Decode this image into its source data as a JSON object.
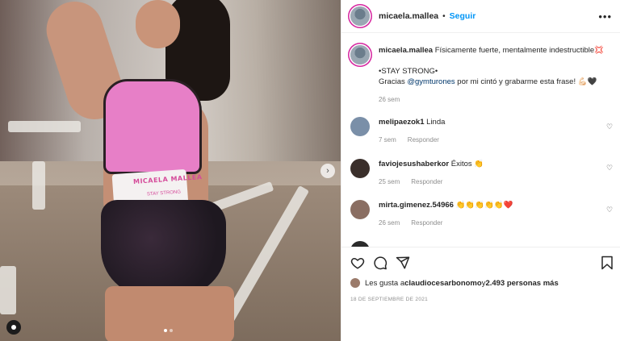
{
  "post": {
    "username": "micaela.mallea",
    "follow_label": "Seguir",
    "separator": "•",
    "more_label": "•••",
    "belt_text_1": "MICAELA MALLEA",
    "belt_text_2": "STAY STRONG",
    "carousel": {
      "total_slides": 2,
      "current_slide": 1
    }
  },
  "caption": {
    "username": "micaela.mallea",
    "text_1": "Físicamente fuerte, mentalmente indestructible",
    "emoji_1": "💢",
    "text_2": "•STAY STRONG•",
    "text_3_pre": "Gracias ",
    "mention": "@gymturones",
    "text_3_post": " por mi cintó y grabarme esta frase! ",
    "emoji_2": "💪🏻🖤",
    "time": "26 sem"
  },
  "comments": [
    {
      "username": "melipaezok1",
      "text": "Linda",
      "time": "7 sem",
      "reply": "Responder",
      "avatar_color": "#7a8fa8"
    },
    {
      "username": "faviojesushaberkor",
      "text": "Éxitos ",
      "emoji": "👏",
      "time": "25 sem",
      "reply": "Responder",
      "avatar_color": "#3a2f2b"
    },
    {
      "username": "mirta.gimenez.54966",
      "text": "",
      "emoji": "👏👏👏👏👏❤️",
      "time": "26 sem",
      "reply": "Responder",
      "avatar_color": "#8a6e62"
    }
  ],
  "actions": {
    "likes_prefix": "Les gusta a ",
    "likes_user": "claudiocesarbonomo",
    "likes_mid": " y ",
    "likes_count": "2.493 personas más",
    "date": "18 DE SEPTIEMBRE DE 2021"
  },
  "icons": [
    "heart-icon",
    "comment-icon",
    "share-icon",
    "bookmark-icon",
    "chevron-right-icon",
    "user-tag-icon",
    "more-icon"
  ]
}
